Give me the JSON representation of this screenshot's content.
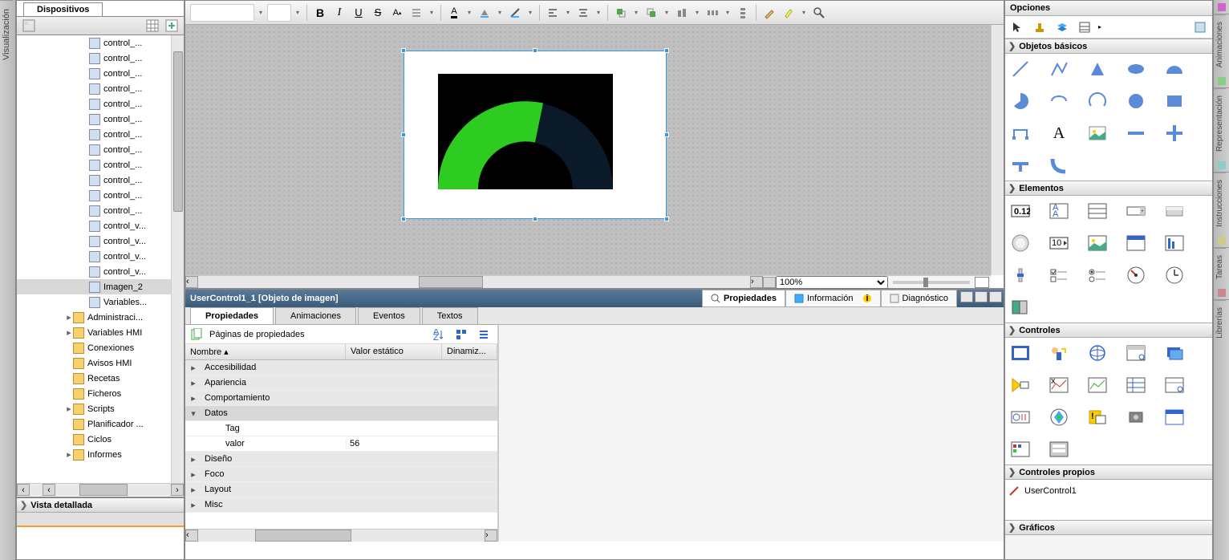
{
  "leftVTab": "Visualización",
  "tree": {
    "tab": "Dispositivos",
    "items": [
      {
        "label": "control_..."
      },
      {
        "label": "control_..."
      },
      {
        "label": "control_..."
      },
      {
        "label": "control_..."
      },
      {
        "label": "control_..."
      },
      {
        "label": "control_..."
      },
      {
        "label": "control_..."
      },
      {
        "label": "control_..."
      },
      {
        "label": "control_..."
      },
      {
        "label": "control_..."
      },
      {
        "label": "control_..."
      },
      {
        "label": "control_..."
      },
      {
        "label": "control_v..."
      },
      {
        "label": "control_v..."
      },
      {
        "label": "control_v..."
      },
      {
        "label": "control_v..."
      },
      {
        "label": "Imagen_2",
        "selected": true
      },
      {
        "label": "Variables..."
      }
    ],
    "folders": [
      {
        "label": "Administraci...",
        "arrow": "▸"
      },
      {
        "label": "Variables HMI",
        "arrow": "▸"
      },
      {
        "label": "Conexiones"
      },
      {
        "label": "Avisos HMI"
      },
      {
        "label": "Recetas"
      },
      {
        "label": "Ficheros"
      },
      {
        "label": "Scripts",
        "arrow": "▸"
      },
      {
        "label": "Planificador ..."
      },
      {
        "label": "Ciclos"
      },
      {
        "label": "Informes",
        "arrow": "▸"
      }
    ]
  },
  "detail": {
    "title": "Vista detallada"
  },
  "canvas": {
    "zoom": "100%"
  },
  "props": {
    "title": "UserControl1_1 [Objeto de imagen]",
    "rtabs": [
      "Propiedades",
      "Información",
      "Diagnóstico"
    ],
    "subtabs": [
      "Propiedades",
      "Animaciones",
      "Eventos",
      "Textos"
    ],
    "pagesLabel": "Páginas de propiedades",
    "cols": {
      "name": "Nombre",
      "val": "Valor estático",
      "dyn": "Dinamiz..."
    },
    "rows": [
      {
        "type": "cat",
        "name": "Accesibilidad"
      },
      {
        "type": "cat",
        "name": "Apariencia"
      },
      {
        "type": "cat",
        "name": "Comportamiento"
      },
      {
        "type": "cat",
        "name": "Datos",
        "expanded": true
      },
      {
        "type": "sub",
        "name": "Tag",
        "val": ""
      },
      {
        "type": "sub",
        "name": "valor",
        "val": "56"
      },
      {
        "type": "cat",
        "name": "Diseño"
      },
      {
        "type": "cat",
        "name": "Foco"
      },
      {
        "type": "cat",
        "name": "Layout"
      },
      {
        "type": "cat",
        "name": "Misc"
      }
    ]
  },
  "toolbox": {
    "title": "Opciones",
    "sections": {
      "basic": "Objetos básicos",
      "elements": "Elementos",
      "controls": "Controles",
      "own": "Controles propios",
      "graphics": "Gráficos"
    },
    "ownItem": "UserControl1"
  },
  "rightVTabs": [
    "Animaciones",
    "Representación",
    "Instrucciones",
    "Tareas",
    "Librerías"
  ]
}
